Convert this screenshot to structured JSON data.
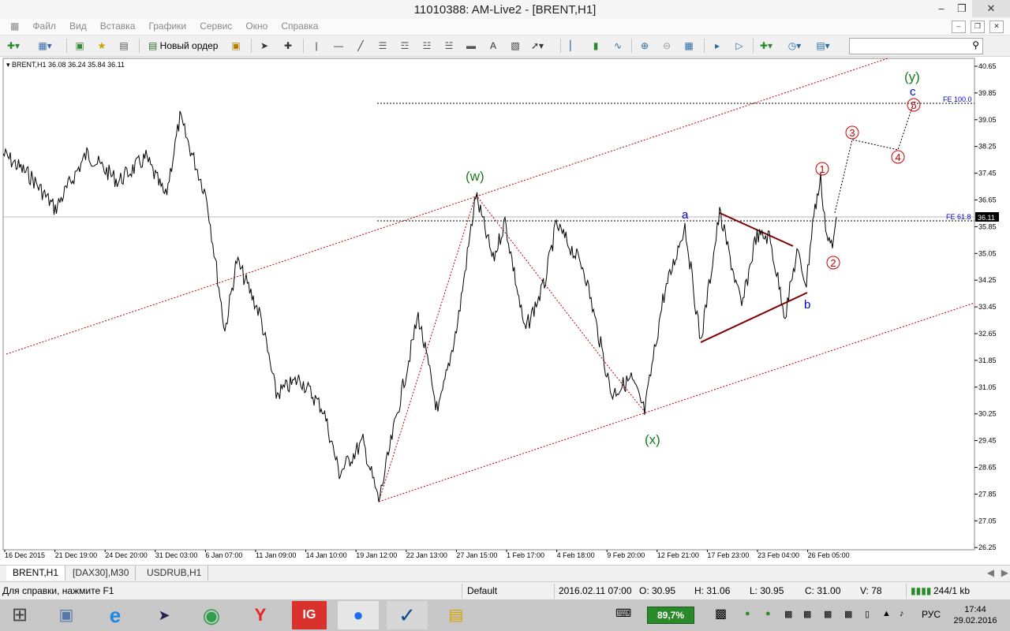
{
  "window": {
    "title": "11010388: AM-Live2 - [BRENT,H1]"
  },
  "menu": [
    "Файл",
    "Вид",
    "Вставка",
    "Графики",
    "Сервис",
    "Окно",
    "Справка"
  ],
  "toolbar": {
    "new_order_label": "Новый ордер"
  },
  "chart_info": "BRENT,H1  36.08 36.24 35.84 36.11",
  "price_axis": [
    "40.65",
    "39.85",
    "39.05",
    "38.25",
    "37.45",
    "36.65",
    "35.85",
    "35.05",
    "34.25",
    "33.45",
    "32.65",
    "31.85",
    "31.05",
    "30.25",
    "29.45",
    "28.65",
    "27.85",
    "27.05",
    "26.25"
  ],
  "current_price": "36.11",
  "time_axis": [
    "16 Dec 2015",
    "21 Dec 19:00",
    "24 Dec 20:00",
    "31 Dec 03:00",
    "6 Jan 07:00",
    "11 Jan 09:00",
    "14 Jan 10:00",
    "19 Jan 12:00",
    "22 Jan 13:00",
    "27 Jan 15:00",
    "1 Feb 17:00",
    "4 Feb 18:00",
    "9 Feb 20:00",
    "12 Feb 21:00",
    "17 Feb 23:00",
    "23 Feb 04:00",
    "26 Feb 05:00"
  ],
  "fe_labels": {
    "fe100": "FE 100.0",
    "fe618": "FE 61.8"
  },
  "wave_labels": {
    "w": "(w)",
    "x": "(x)",
    "y": "(y)",
    "a": "a",
    "b": "b",
    "c": "c",
    "n1": "1",
    "n2": "2",
    "n3": "3",
    "n4": "4",
    "n5": "5"
  },
  "tabs": [
    "BRENT,H1",
    "[DAX30],M30",
    "USDRUB,H1"
  ],
  "status": {
    "help": "Для справки, нажмите F1",
    "profile": "Default",
    "datetime": "2016.02.11 07:00",
    "open": "O: 30.95",
    "high": "H: 31.06",
    "low": "L: 30.95",
    "close": "C: 31.00",
    "volume": "V: 78",
    "traffic": "244/1 kb"
  },
  "taskbar": {
    "battery": "89,7%",
    "lang": "РУС",
    "time": "17:44",
    "date": "29.02.2016"
  },
  "colors": {
    "price_line": "#000000",
    "channel": "#c00000",
    "triangle": "#800000",
    "green_label": "#1a7a1a",
    "blue_label": "#0000cc",
    "red_label": "#cc0000"
  }
}
